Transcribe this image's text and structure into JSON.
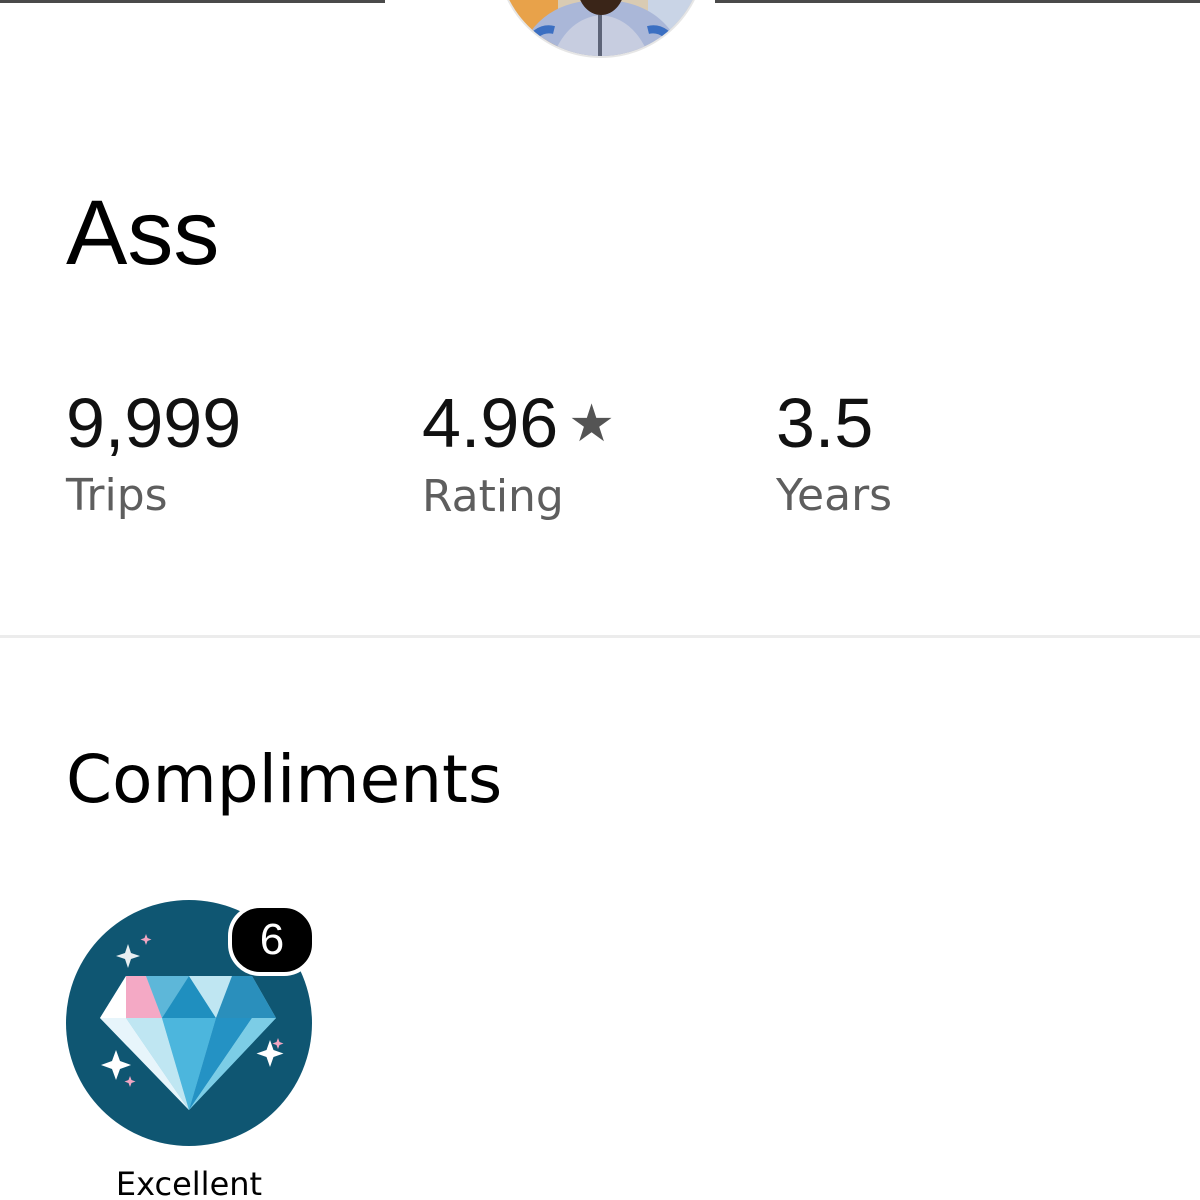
{
  "profile": {
    "name": "Ass",
    "avatar_alt": "driver profile photo"
  },
  "stats": [
    {
      "value": "9,999",
      "label": "Trips"
    },
    {
      "value": "4.96",
      "label": "Rating",
      "icon": "star-icon"
    },
    {
      "value": "3.5",
      "label": "Years"
    }
  ],
  "compliments": {
    "title": "Compliments",
    "items": [
      {
        "label": "Excellent",
        "count": "6",
        "icon": "diamond-icon"
      }
    ]
  },
  "colors": {
    "badge_bg": "#0f5672",
    "count_bg": "#000000",
    "label_gray": "#5e5e5e"
  }
}
